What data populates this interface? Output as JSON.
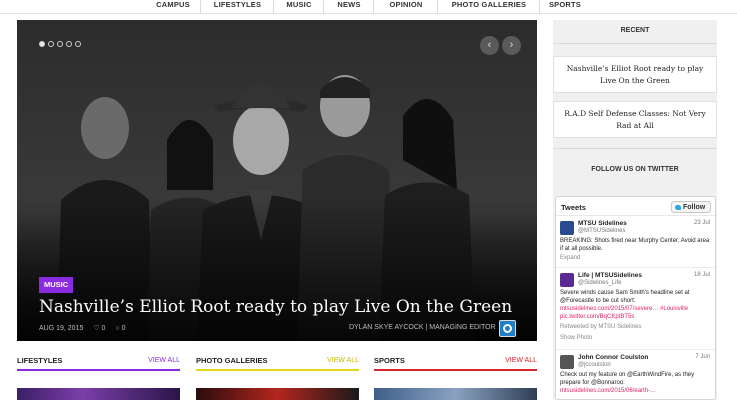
{
  "nav": {
    "items": [
      "CAMPUS",
      "LIFESTYLES",
      "MUSIC",
      "NEWS",
      "OPINION",
      "PHOTO GALLERIES",
      "SPORTS"
    ]
  },
  "hero": {
    "category": "MUSIC",
    "title": "Nashville’s Elliot Root ready to play Live On the Green",
    "date": "AUG 19, 2015",
    "likes": "♡ 0",
    "comments": "○ 0",
    "author": "DYLAN SKYE AYCOCK | MANAGING EDITOR",
    "prev_arrow": "‹",
    "next_arrow": "›",
    "active_slide": 1,
    "slide_count": 5,
    "category_color": "#8a2be2"
  },
  "sections": [
    {
      "label": "LIFESTYLES",
      "view_all": "VIEW ALL",
      "color": "#8a2be2"
    },
    {
      "label": "PHOTO GALLERIES",
      "view_all": "VIEW ALL",
      "color": "#e5d81a"
    },
    {
      "label": "SPORTS",
      "view_all": "VIEW ALL",
      "color": "#d9262c"
    }
  ],
  "sidebar": {
    "recent_heading": "RECENT",
    "recent": [
      "Nashville’s Elliot Root ready to play Live On the Green",
      "R.A.D Self Defense Classes: Not Very Rad at All"
    ],
    "twitter_heading": "FOLLOW US ON TWITTER"
  },
  "twitter": {
    "title": "Tweets",
    "follow_label": "Follow",
    "tweets": [
      {
        "name": "MTSU Sidelines",
        "handle": "@MTSUSidelines",
        "date": "23 Jul",
        "text": "BREAKING: Shots fired near Murphy Center. Avoid area if at all possible.",
        "action": "Expand"
      },
      {
        "name": "Life | MTSUSidelines",
        "handle": "@Sidelines_Life",
        "date": "18 Jul",
        "text": "Severe winds cause Sam Smith's headline set at @Forecastle to be cut short:",
        "links": "mtsusidelines.com/2015/07/severe… #Louisville pic.twitter.com/BqCKptBT5s",
        "retweet": "Retweeted by MTSU Sidelines",
        "action": "Show Photo"
      },
      {
        "name": "John Connor Coulston",
        "handle": "@jccoulston",
        "date": "7 Jun",
        "text": "Check out my feature on @EarthWindFire, as they prepare for @Bonnaroo:",
        "links": "mtsusidelines.com/2015/06/earth-…"
      }
    ]
  },
  "colors": {
    "link": "#e0245e",
    "accent_blue": "#1f7fc7"
  }
}
